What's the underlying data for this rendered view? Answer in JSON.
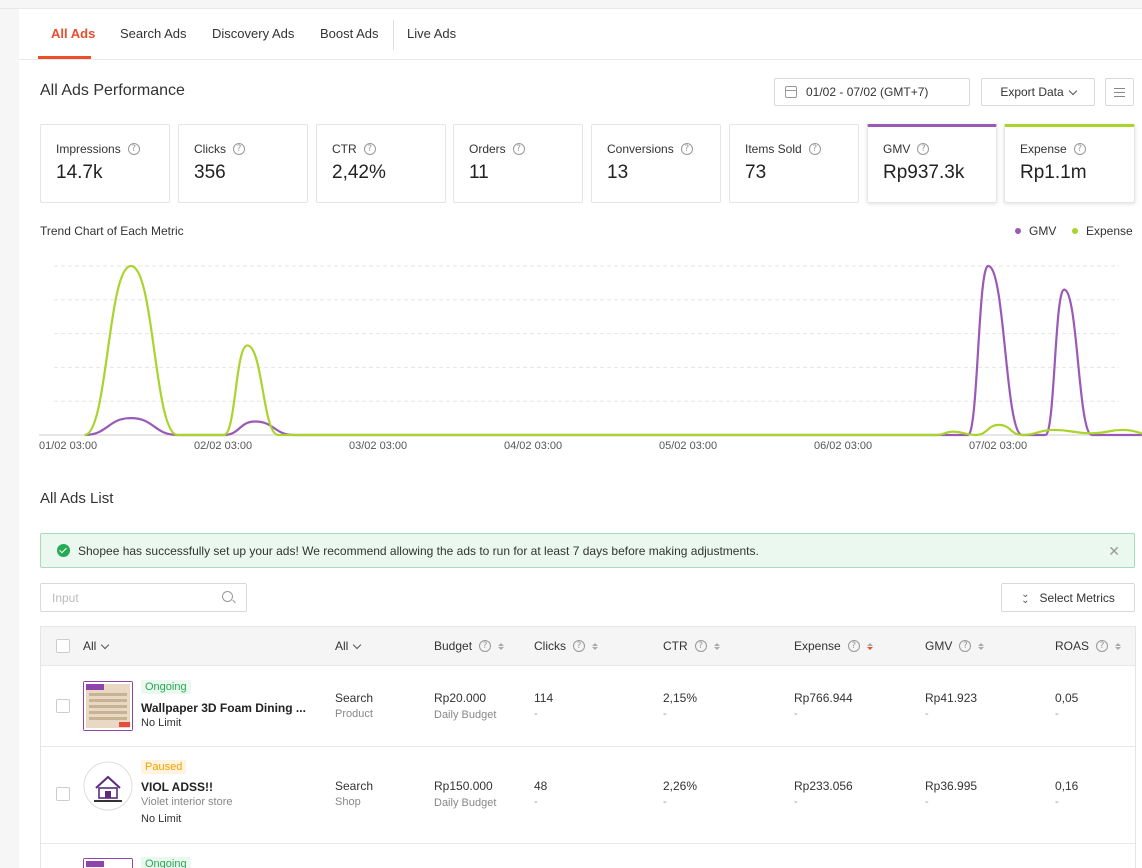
{
  "tabs": [
    "All Ads",
    "Search Ads",
    "Discovery Ads",
    "Boost Ads",
    "Live Ads"
  ],
  "performance": {
    "title": "All Ads Performance",
    "date_range": "01/02 - 07/02 (GMT+7)",
    "export_label": "Export Data"
  },
  "metrics": [
    {
      "label": "Impressions",
      "value": "14.7k"
    },
    {
      "label": "Clicks",
      "value": "356"
    },
    {
      "label": "CTR",
      "value": "2,42%"
    },
    {
      "label": "Orders",
      "value": "11"
    },
    {
      "label": "Conversions",
      "value": "13"
    },
    {
      "label": "Items Sold",
      "value": "73"
    },
    {
      "label": "GMV",
      "value": "Rp937.3k"
    },
    {
      "label": "Expense",
      "value": "Rp1.1m"
    }
  ],
  "trend": {
    "title": "Trend Chart of Each Metric",
    "legend": [
      "GMV",
      "Expense"
    ]
  },
  "chart_data": {
    "type": "line",
    "x_ticks": [
      "01/02 03:00",
      "02/02 03:00",
      "03/02 03:00",
      "04/02 03:00",
      "05/02 03:00",
      "06/02 03:00",
      "07/02 03:00"
    ],
    "series": [
      {
        "name": "GMV",
        "color": "#9b59b6",
        "points": [
          [
            0.1,
            0
          ],
          [
            0.4,
            10
          ],
          [
            0.7,
            0
          ],
          [
            1.0,
            0
          ],
          [
            1.2,
            8
          ],
          [
            1.45,
            0
          ],
          [
            5.8,
            0
          ],
          [
            5.93,
            100
          ],
          [
            6.15,
            0
          ],
          [
            6.3,
            0
          ],
          [
            6.42,
            86
          ],
          [
            6.6,
            0
          ],
          [
            7.0,
            0
          ]
        ]
      },
      {
        "name": "Expense",
        "color": "#a8d42b",
        "points": [
          [
            0.1,
            0
          ],
          [
            0.4,
            100
          ],
          [
            0.7,
            0
          ],
          [
            1.0,
            0
          ],
          [
            1.15,
            53
          ],
          [
            1.35,
            0
          ],
          [
            5.6,
            0
          ],
          [
            5.7,
            2
          ],
          [
            5.85,
            0
          ],
          [
            6.0,
            6
          ],
          [
            6.15,
            0
          ],
          [
            6.35,
            3
          ],
          [
            6.6,
            1
          ],
          [
            6.8,
            3
          ],
          [
            7.0,
            0
          ]
        ]
      }
    ]
  },
  "list": {
    "title": "All Ads List",
    "alert": "Shopee has successfully set up your ads! We recommend allowing the ads to run for at least 7 days before making adjustments.",
    "search_placeholder": "Input",
    "select_metrics": "Select Metrics",
    "columns": {
      "all_ads": "All",
      "all_type": "All",
      "budget": "Budget",
      "clicks": "Clicks",
      "ctr": "CTR",
      "expense": "Expense",
      "gmv": "GMV",
      "roas": "ROAS"
    },
    "rows": [
      {
        "status": "Ongoing",
        "name": "Wallpaper 3D Foam Dining ...",
        "store": "",
        "limit": "No Limit",
        "type": "Search",
        "type_sub": "Product",
        "budget": "Rp20.000",
        "budget_sub": "Daily Budget",
        "clicks": "114",
        "ctr": "2,15%",
        "expense": "Rp766.944",
        "gmv": "Rp41.923",
        "roas": "0,05",
        "dash": "-"
      },
      {
        "status": "Paused",
        "name": "VIOL ADSS!!",
        "store": "Violet interior store",
        "limit": "No Limit",
        "type": "Search",
        "type_sub": "Shop",
        "budget": "Rp150.000",
        "budget_sub": "Daily Budget",
        "clicks": "48",
        "ctr": "2,26%",
        "expense": "Rp233.056",
        "gmv": "Rp36.995",
        "roas": "0,16",
        "dash": "-"
      },
      {
        "status": "Ongoing"
      }
    ]
  }
}
